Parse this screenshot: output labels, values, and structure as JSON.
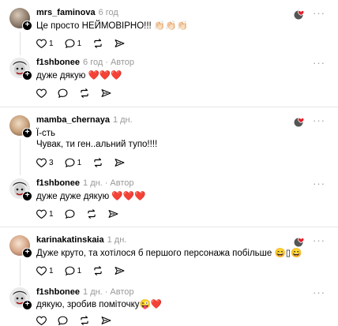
{
  "comments": [
    {
      "username": "mrs_faminova",
      "time": "6 год",
      "text": "Це просто НЕЙМОВІРНО!!! 👏🏻👏🏻👏🏻",
      "likes": "1",
      "replies": "1"
    },
    {
      "username": "f1shbonee",
      "time": "6 год",
      "author_badge": "Автор",
      "text": "дуже дякую ❤️❤️❤️"
    },
    {
      "username": "mamba_chernaya",
      "time": "1 дн.",
      "text_line1": "Ї-сть",
      "text_line2": "Чувак, ти ген..альний тупо!!!!",
      "likes": "3",
      "replies": "1"
    },
    {
      "username": "f1shbonee",
      "time": "1 дн.",
      "author_badge": "Автор",
      "text": "дуже дуже дякую ❤️❤️❤️",
      "likes": "1"
    },
    {
      "username": "karinakatinskaia",
      "time": "1 дн.",
      "text": "Дуже круто, та хотілося б першого персонажа побільше 😄▯😄",
      "likes": "1",
      "replies": "1"
    },
    {
      "username": "f1shbonee",
      "time": "1 дн.",
      "author_badge": "Автор",
      "text": "дякую, зробив поміточку😜❤️"
    }
  ],
  "more_label": "···",
  "colors": {
    "accent_like": "#e0202a",
    "muted": "#999999",
    "divider": "#e6e6e6"
  }
}
